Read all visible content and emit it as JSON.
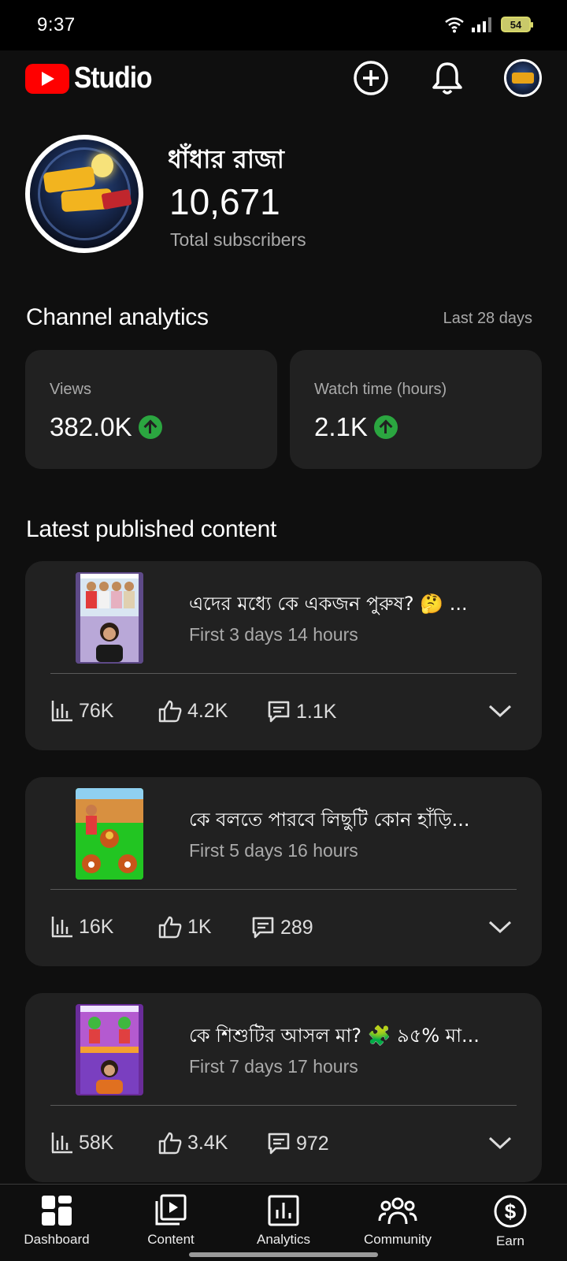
{
  "status_bar": {
    "time": "9:37",
    "battery": "54"
  },
  "app": {
    "logo_text": "Studio"
  },
  "channel": {
    "name": "ধাঁধার রাজা",
    "subscriber_count": "10,671",
    "subscriber_label": "Total subscribers"
  },
  "analytics": {
    "title": "Channel analytics",
    "period": "Last 28 days",
    "cards": [
      {
        "label": "Views",
        "value": "382.0K",
        "trend": "up"
      },
      {
        "label": "Watch time (hours)",
        "value": "2.1K",
        "trend": "up"
      }
    ]
  },
  "latest": {
    "title": "Latest published content",
    "items": [
      {
        "title": "এদের মধ্যে কে একজন পুরুষ? 🤔 ...",
        "age": "First 3 days 14 hours",
        "views": "76K",
        "likes": "4.2K",
        "comments": "1.1K"
      },
      {
        "title": "কে বলতে পারবে লিছুটি কোন হাঁড়ি...",
        "age": "First 5 days 16 hours",
        "views": "16K",
        "likes": "1K",
        "comments": "289"
      },
      {
        "title": "কে শিশুটির আসল মা? 🧩 ৯৫% মা...",
        "age": "First 7 days 17 hours",
        "views": "58K",
        "likes": "3.4K",
        "comments": "972"
      }
    ]
  },
  "nav": {
    "items": [
      {
        "label": "Dashboard",
        "icon": "dashboard-icon"
      },
      {
        "label": "Content",
        "icon": "content-icon"
      },
      {
        "label": "Analytics",
        "icon": "analytics-icon"
      },
      {
        "label": "Community",
        "icon": "community-icon"
      },
      {
        "label": "Earn",
        "icon": "earn-icon"
      }
    ]
  },
  "colors": {
    "accent": "#ff0000",
    "trend_up": "#2ba640",
    "card_bg": "#212121",
    "page_bg": "#0f0f0f"
  }
}
